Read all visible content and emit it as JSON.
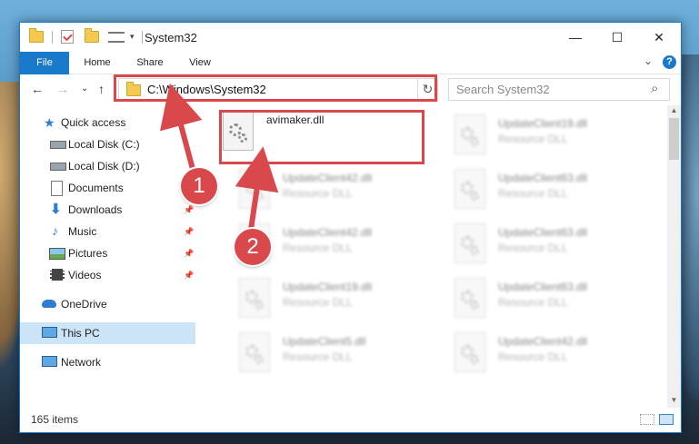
{
  "window": {
    "title": "System32",
    "minimize": "—",
    "maximize": "☐",
    "close": "✕"
  },
  "ribbon": {
    "tabs": [
      "File",
      "Home",
      "Share",
      "View"
    ],
    "help": "?",
    "expand": "⌄"
  },
  "nav": {
    "back": "←",
    "forward": "→",
    "recent": "⌄",
    "up": "↑",
    "address": "C:\\Windows\\System32",
    "address_dropdown": "⌄",
    "refresh": "↻",
    "search_placeholder": "Search System32",
    "search_icon": "⌕"
  },
  "sidebar": {
    "items": [
      {
        "label": "Quick access",
        "icon": "star-icon"
      },
      {
        "label": "Local Disk (C:)",
        "icon": "drive-icon"
      },
      {
        "label": "Local Disk (D:)",
        "icon": "drive-icon"
      },
      {
        "label": "Documents",
        "icon": "documents-icon",
        "pinned": true
      },
      {
        "label": "Downloads",
        "icon": "download-icon",
        "pinned": true
      },
      {
        "label": "Music",
        "icon": "music-icon",
        "pinned": true
      },
      {
        "label": "Pictures",
        "icon": "pictures-icon",
        "pinned": true
      },
      {
        "label": "Videos",
        "icon": "videos-icon",
        "pinned": true
      },
      {
        "label": "OneDrive",
        "icon": "cloud-icon"
      },
      {
        "label": "This PC",
        "icon": "computer-icon",
        "selected": true
      },
      {
        "label": "Network",
        "icon": "network-icon"
      }
    ]
  },
  "files": [
    {
      "name": "avimaker.dll",
      "type": "",
      "selected": true
    },
    {
      "name": "UpdateClient19.dll",
      "type": "Resource DLL"
    },
    {
      "name": "UpdateClient42.dll",
      "type": "Resource DLL"
    },
    {
      "name": "UpdateClient63.dll",
      "type": "Resource DLL"
    },
    {
      "name": "UpdateClient42.dll",
      "type": "Resource DLL"
    },
    {
      "name": "UpdateClient63.dll",
      "type": "Resource DLL"
    },
    {
      "name": "UpdateClient19.dll",
      "type": "Resource DLL"
    },
    {
      "name": "UpdateClient63.dll",
      "type": "Resource DLL"
    },
    {
      "name": "UpdateClient5.dll",
      "type": "Resource DLL"
    },
    {
      "name": "UpdateClient42.dll",
      "type": "Resource DLL"
    }
  ],
  "status": {
    "item_count": "165 items"
  },
  "annotations": {
    "step1": "1",
    "step2": "2",
    "color": "#d9484a"
  }
}
